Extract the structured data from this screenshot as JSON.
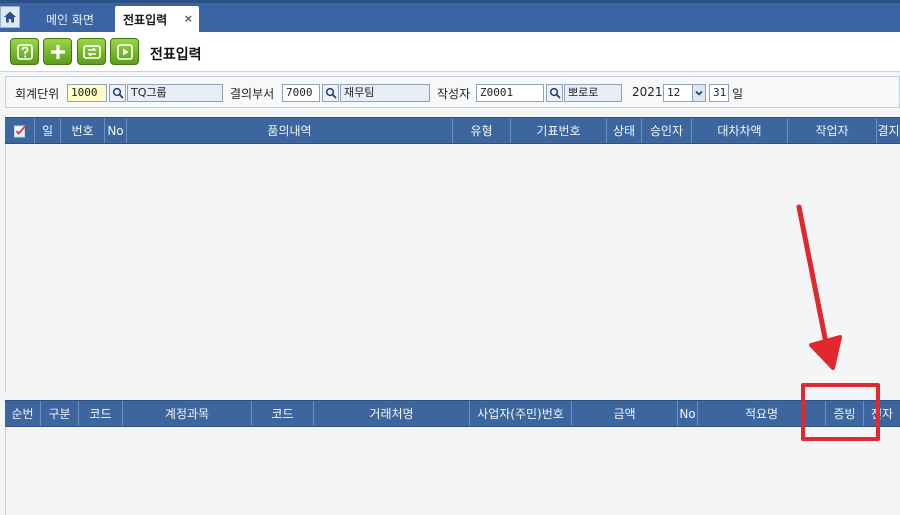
{
  "tabs": {
    "main": "메인 화면",
    "active": "전표입력",
    "close": "×"
  },
  "toolbar": {
    "title": "전표입력"
  },
  "filters": {
    "unit_label": "회계단위",
    "unit_code": "1000",
    "unit_name": "TQ그룹",
    "dept_label": "결의부서",
    "dept_code": "7000",
    "dept_name": "재무팀",
    "writer_label": "작성자",
    "writer_code": "Z0001",
    "writer_name": "뽀로로",
    "year": "2021",
    "month": "12",
    "day": "31",
    "day_label": "일"
  },
  "top_grid": {
    "headers": [
      "일",
      "번호",
      "No",
      "품의내역",
      "유형",
      "기표번호",
      "상태",
      "승인자",
      "대차차액",
      "작업자",
      "결지"
    ]
  },
  "bottom_grid": {
    "headers": [
      "순번",
      "구분",
      "코드",
      "계정과목",
      "코드",
      "거래처명",
      "사업자(주민)번호",
      "금액",
      "No",
      "적요명",
      "증빙",
      "전자"
    ]
  },
  "colors": {
    "header_bg": "#3d669f",
    "tab_bar": "#3a64a4",
    "input_highlight": "#fffcc6",
    "annotation": "#e0282f"
  }
}
